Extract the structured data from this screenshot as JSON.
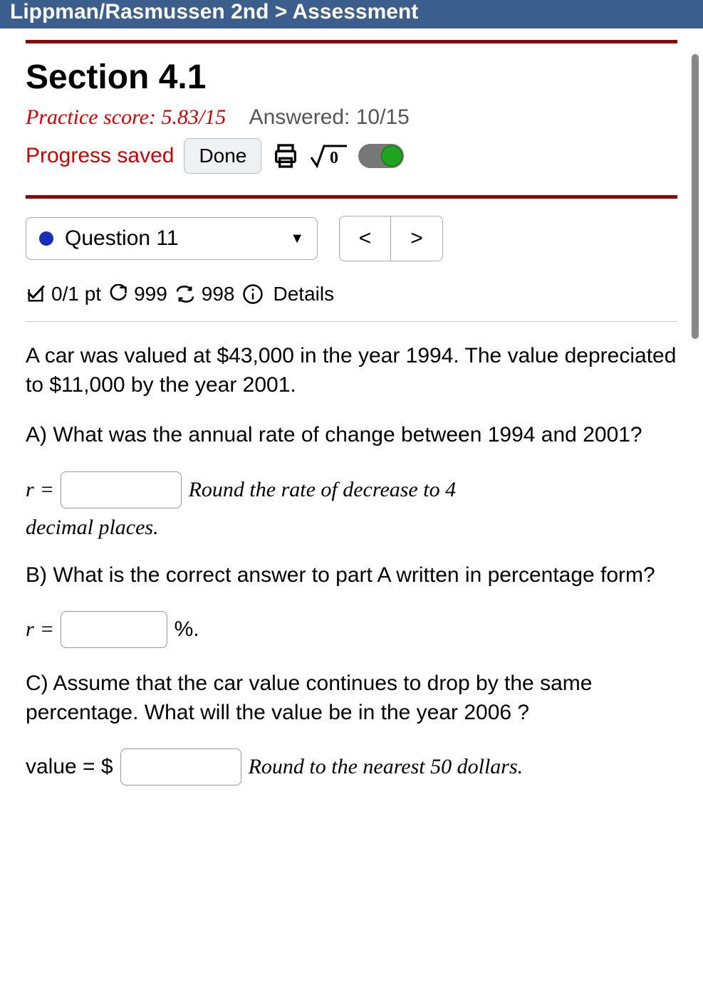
{
  "topbar": "Lippman/Rasmussen 2nd > Assessment",
  "header": {
    "title": "Section 4.1",
    "practice_label": "Practice score: 5.83/15",
    "answered_label": "Answered: 10/15",
    "progress_saved": "Progress saved",
    "done_label": "Done"
  },
  "nav": {
    "question_label": "Question 11",
    "prev": "<",
    "next": ">"
  },
  "meta": {
    "points": "0/1 pt",
    "tries": "999",
    "regen": "998",
    "details": "Details"
  },
  "question": {
    "intro": "A car was valued at $43,000 in the year 1994. The value depreciated to $11,000 by the year 2001.",
    "parts": {
      "a": {
        "prompt": "A) What was the annual rate of change between 1994 and 2001?",
        "var": "r",
        "eq": " = ",
        "hint_before": "Round the rate of decrease to 4",
        "hint_after": "decimal places."
      },
      "b": {
        "prompt": "B) What is the correct answer to part A written in percentage form?",
        "var": "r",
        "eq": " = ",
        "suffix": "%."
      },
      "c": {
        "prompt": "C) Assume that the car value continues to drop by the same percentage. What will the value be in the year 2006 ?",
        "label": "value = $",
        "hint": "Round to the nearest 50 dollars."
      }
    }
  }
}
